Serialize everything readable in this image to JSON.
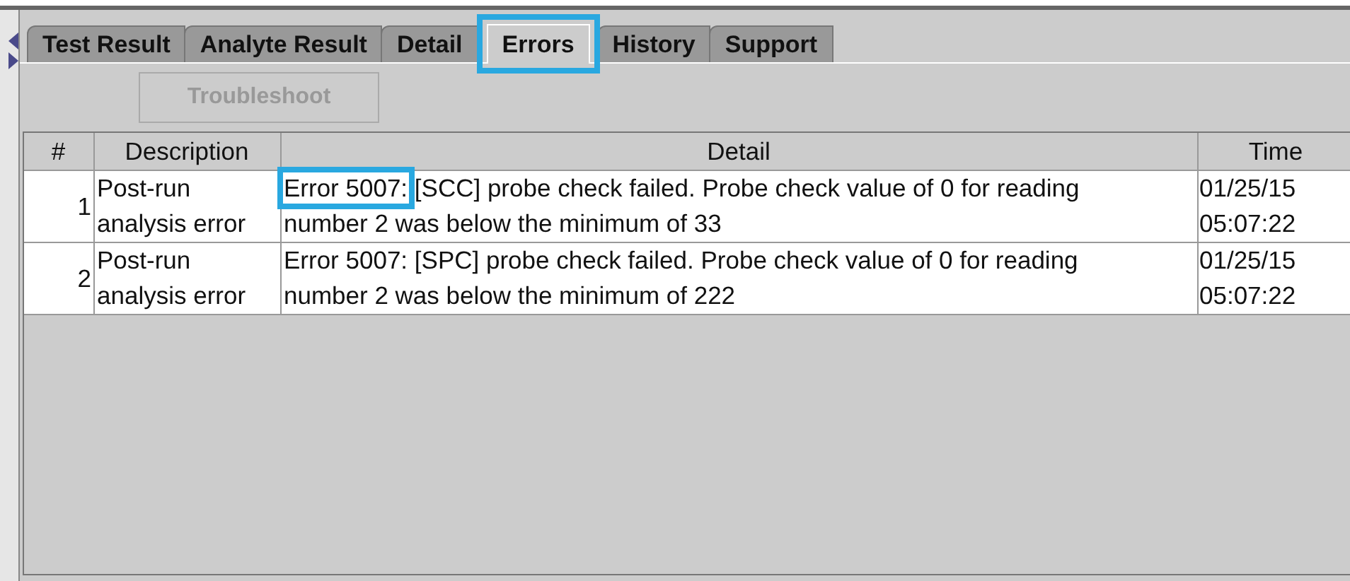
{
  "tabs": [
    {
      "label": "Test Result",
      "selected": false,
      "highlighted": false
    },
    {
      "label": "Analyte Result",
      "selected": false,
      "highlighted": false
    },
    {
      "label": "Detail",
      "selected": false,
      "highlighted": false
    },
    {
      "label": "Errors",
      "selected": true,
      "highlighted": true
    },
    {
      "label": "History",
      "selected": false,
      "highlighted": false
    },
    {
      "label": "Support",
      "selected": false,
      "highlighted": false
    }
  ],
  "toolbar": {
    "button": {
      "label": "Troubleshoot",
      "disabled": true
    }
  },
  "table": {
    "columns": [
      "#",
      "Description",
      "Detail",
      "Time"
    ],
    "rows": [
      {
        "number": "1",
        "description": "Post-run analysis error",
        "detail": [
          {
            "text": "Error 5007:",
            "highlighted": true
          },
          {
            "text": " [SCC] probe check failed. Probe check value of 0 for reading number 2 was below the minimum of 33"
          }
        ],
        "time": "01/25/15 05:07:22"
      },
      {
        "number": "2",
        "description": "Post-run analysis error",
        "detail": [
          {
            "text": "Error 5007:",
            "highlighted": false
          },
          {
            "text": " [SPC] probe check failed. Probe check value of 0 for reading number 2 was below the minimum of 222"
          }
        ],
        "time": "01/25/15 05:07:22"
      }
    ]
  }
}
